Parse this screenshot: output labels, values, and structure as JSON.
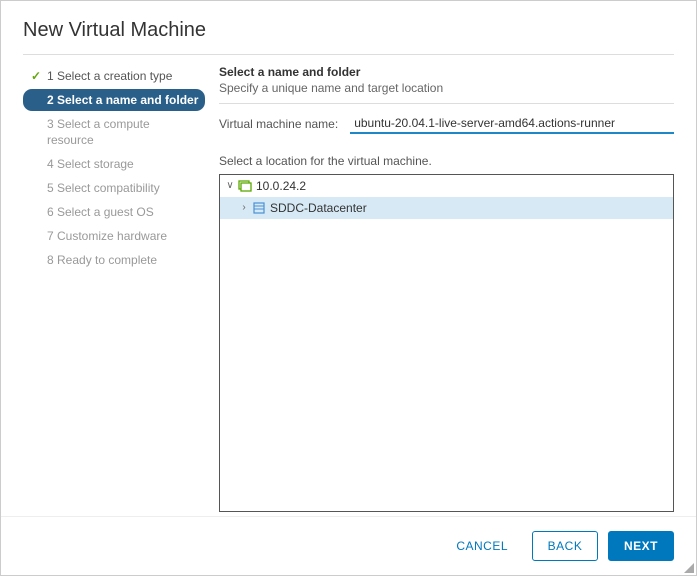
{
  "title": "New Virtual Machine",
  "sidebar": {
    "steps": [
      {
        "label": "1 Select a creation type"
      },
      {
        "label": "2 Select a name and folder"
      },
      {
        "label": "3 Select a compute resource"
      },
      {
        "label": "4 Select storage"
      },
      {
        "label": "5 Select compatibility"
      },
      {
        "label": "6 Select a guest OS"
      },
      {
        "label": "7 Customize hardware"
      },
      {
        "label": "8 Ready to complete"
      }
    ]
  },
  "section": {
    "heading": "Select a name and folder",
    "sub": "Specify a unique name and target location"
  },
  "vm_name": {
    "label": "Virtual machine name:",
    "value": "ubuntu-20.04.1-live-server-amd64.actions-runner"
  },
  "location": {
    "label": "Select a location for the virtual machine.",
    "root": {
      "label": "10.0.24.2"
    },
    "child": {
      "label": "SDDC-Datacenter"
    }
  },
  "footer": {
    "cancel": "CANCEL",
    "back": "BACK",
    "next": "NEXT"
  },
  "icons": {
    "check": "✓",
    "collapse": "∨",
    "expand": "›"
  }
}
